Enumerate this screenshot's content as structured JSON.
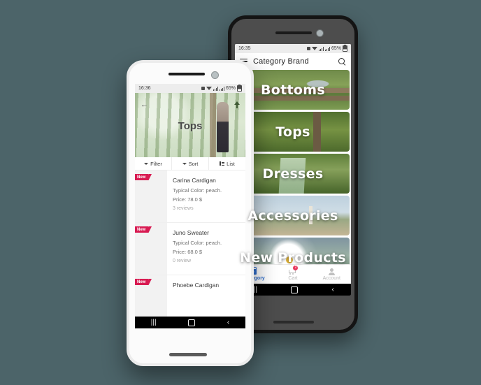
{
  "background_color": "#4c6469",
  "back_phone": {
    "device_color": "#4d4d4d",
    "status_bar": {
      "time": "16:35",
      "battery": "65%",
      "icons": [
        "alarm-icon",
        "wifi-icon",
        "signal-icon",
        "signal-icon",
        "battery-icon"
      ]
    },
    "app_bar": {
      "menu_icon": "hamburger-icon",
      "title": "Category Brand",
      "search_icon": "search-icon"
    },
    "categories": [
      {
        "label": "Bottoms",
        "style": "bg-bottoms"
      },
      {
        "label": "Tops",
        "style": "bg-tops"
      },
      {
        "label": "Dresses",
        "style": "bg-dresses"
      },
      {
        "label": "Accessories",
        "style": "bg-accessories"
      },
      {
        "label": "New Products",
        "style": "bg-new"
      }
    ],
    "bottom_nav": {
      "active_color": "#2f6fd0",
      "inactive_color": "#b6b6b6",
      "items": [
        {
          "label": "Category",
          "icon": "shopping-bag-icon",
          "active": true,
          "badge": ""
        },
        {
          "label": "Cart",
          "icon": "cart-icon",
          "active": false,
          "badge": "2"
        },
        {
          "label": "Account",
          "icon": "person-icon",
          "active": false,
          "badge": ""
        }
      ]
    },
    "android_nav": {
      "recents": "|||",
      "home": "home",
      "back": "‹"
    }
  },
  "front_phone": {
    "device_color": "#fbfbfb",
    "status_bar": {
      "time": "16:36",
      "battery": "65%",
      "icons": [
        "alarm-icon",
        "wifi-icon",
        "signal-icon",
        "signal-icon",
        "battery-icon"
      ]
    },
    "hero": {
      "title": "Tops",
      "back_icon": "back-arrow-icon",
      "action_icon": "upload-icon"
    },
    "toolbar": [
      {
        "label": "Filter",
        "icon": "caret-down-icon"
      },
      {
        "label": "Sort",
        "icon": "caret-down-icon"
      },
      {
        "label": "List",
        "icon": "list-view-icon"
      }
    ],
    "products": [
      {
        "badge": "New",
        "name": "Carina Cardigan",
        "color": "Typical Color: peach.",
        "price": "Price: 78.0 $",
        "reviews": "3 reviews",
        "thumb": "thumb-1"
      },
      {
        "badge": "New",
        "name": "Juno Sweater",
        "color": "Typical Color: peach.",
        "price": "Price: 68.0 $",
        "reviews": "0 review",
        "thumb": "thumb-2"
      },
      {
        "badge": "New",
        "name": "Phoebe Cardigan",
        "color": "",
        "price": "",
        "reviews": "",
        "thumb": "thumb-3"
      }
    ],
    "android_nav": {
      "recents": "|||",
      "home": "home",
      "back": "‹"
    }
  }
}
